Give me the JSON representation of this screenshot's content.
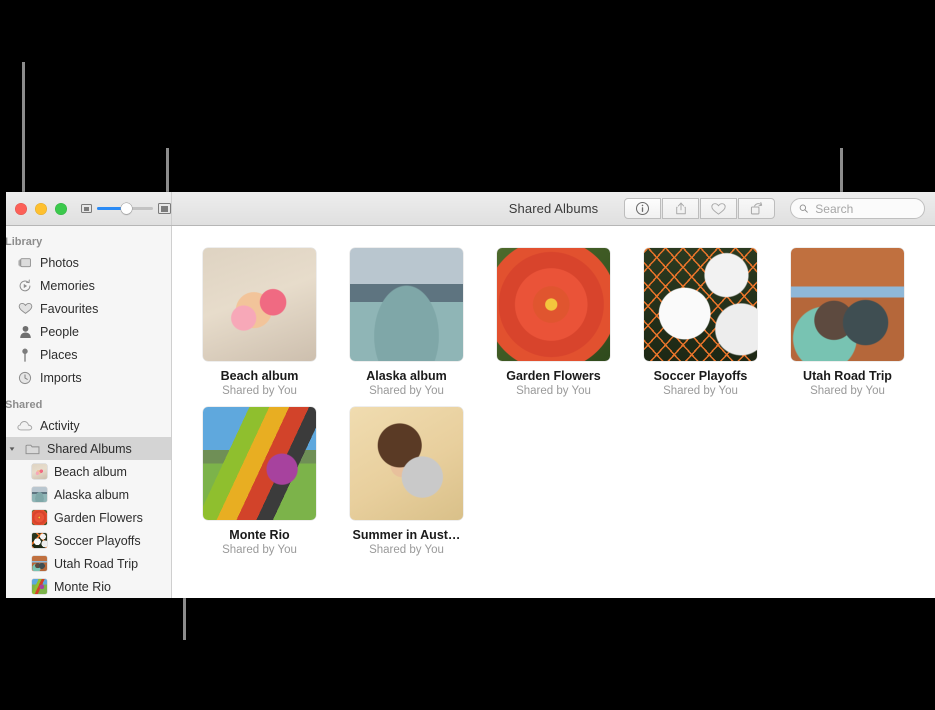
{
  "window": {
    "title": "Shared Albums",
    "traffic_lights": [
      "close",
      "minimize",
      "zoom"
    ],
    "zoom_slider": {
      "value": 52,
      "min_icon": "small-thumbnail-icon",
      "max_icon": "large-thumbnail-icon"
    }
  },
  "toolbar": {
    "buttons": [
      {
        "name": "info-button",
        "icon": "info-icon"
      },
      {
        "name": "share-button",
        "icon": "share-icon"
      },
      {
        "name": "favorite-button",
        "icon": "heart-icon"
      },
      {
        "name": "rotate-button",
        "icon": "rotate-icon"
      }
    ],
    "search": {
      "placeholder": "Search",
      "value": "",
      "icon": "search-icon"
    }
  },
  "sidebar": {
    "sections": [
      {
        "header": "Library",
        "items": [
          {
            "label": "Photos",
            "icon": "photos-icon"
          },
          {
            "label": "Memories",
            "icon": "memories-icon"
          },
          {
            "label": "Favourites",
            "icon": "heart-icon"
          },
          {
            "label": "People",
            "icon": "person-icon"
          },
          {
            "label": "Places",
            "icon": "pin-icon"
          },
          {
            "label": "Imports",
            "icon": "clock-icon"
          }
        ]
      },
      {
        "header": "Shared",
        "items": [
          {
            "label": "Activity",
            "icon": "cloud-icon"
          },
          {
            "label": "Shared Albums",
            "icon": "folder-icon",
            "selected": true,
            "expanded": true
          }
        ],
        "children": [
          {
            "label": "Beach album",
            "art": "art-beach"
          },
          {
            "label": "Alaska album",
            "art": "art-alaska"
          },
          {
            "label": "Garden Flowers",
            "art": "art-flowers"
          },
          {
            "label": "Soccer Playoffs",
            "art": "art-soccer"
          },
          {
            "label": "Utah Road Trip",
            "art": "art-utah"
          },
          {
            "label": "Monte Rio",
            "art": "art-monterio"
          }
        ]
      }
    ]
  },
  "content": {
    "albums": [
      {
        "name": "Beach album",
        "subtitle": "Shared by You",
        "art": "art-beach"
      },
      {
        "name": "Alaska album",
        "subtitle": "Shared by You",
        "art": "art-alaska"
      },
      {
        "name": "Garden Flowers",
        "subtitle": "Shared by You",
        "art": "art-flowers"
      },
      {
        "name": "Soccer Playoffs",
        "subtitle": "Shared by You",
        "art": "art-soccer"
      },
      {
        "name": "Utah Road Trip",
        "subtitle": "Shared by You",
        "art": "art-utah"
      },
      {
        "name": "Monte Rio",
        "subtitle": "Shared by You",
        "art": "art-kite"
      },
      {
        "name": "Summer in Aust…",
        "subtitle": "Shared by You",
        "art": "art-koala"
      }
    ]
  },
  "colors": {
    "accent": "#2b8bf5",
    "selection": "#d4d4d4",
    "leader_line": "#8c8c8c",
    "backdrop": "#000000"
  }
}
